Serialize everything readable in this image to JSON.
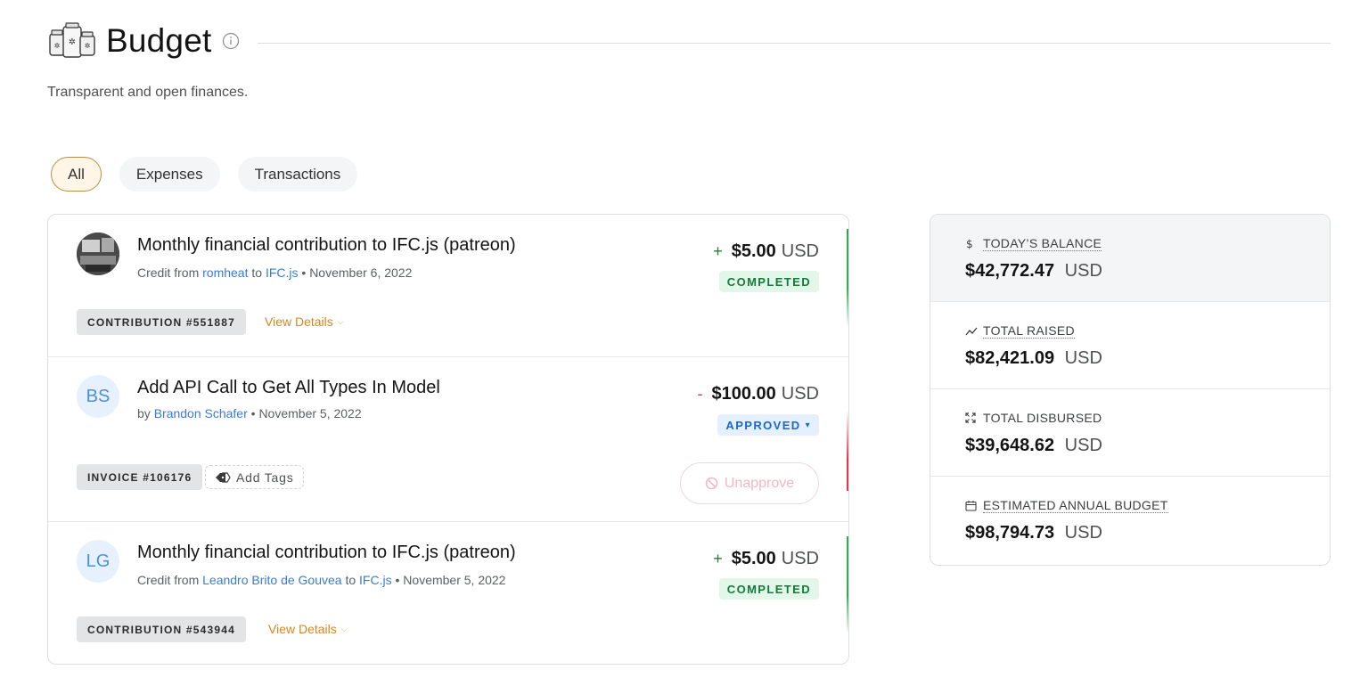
{
  "header": {
    "title": "Budget",
    "subtitle": "Transparent and open finances."
  },
  "tabs": [
    {
      "label": "All",
      "active": true
    },
    {
      "label": "Expenses",
      "active": false
    },
    {
      "label": "Transactions",
      "active": false
    }
  ],
  "transactions": [
    {
      "title": "Monthly financial contribution to IFC.js (patreon)",
      "meta_prefix": "Credit from",
      "from": "romheat",
      "meta_to": "to",
      "to": "IFC.js",
      "date": "• November 6, 2022",
      "sign": "+",
      "amount": "$5.00",
      "currency": "USD",
      "status": "COMPLETED",
      "tag": "CONTRIBUTION #551887",
      "action": "View Details",
      "avatar": "photo"
    },
    {
      "title": "Add API Call to Get All Types In Model",
      "meta_prefix": "by",
      "from": "Brandon Schafer",
      "date": "• November 5, 2022",
      "sign": "-",
      "amount": "$100.00",
      "currency": "USD",
      "status": "APPROVED",
      "tag": "INVOICE #106176",
      "add_tags": "Add Tags",
      "unapprove": "Unapprove",
      "avatar": "BS"
    },
    {
      "title": "Monthly financial contribution to IFC.js (patreon)",
      "meta_prefix": "Credit from",
      "from": "Leandro Brito de Gouvea",
      "meta_to": "to",
      "to": "IFC.js",
      "date": "• November 5, 2022",
      "sign": "+",
      "amount": "$5.00",
      "currency": "USD",
      "status": "COMPLETED",
      "tag": "CONTRIBUTION #543944",
      "action": "View Details",
      "avatar": "LG"
    }
  ],
  "summary": [
    {
      "icon": "dollar-icon",
      "label": "TODAY’S BALANCE",
      "value": "$42,772.47",
      "currency": "USD"
    },
    {
      "icon": "trend-up-icon",
      "label": "TOTAL RAISED",
      "value": "$82,421.09",
      "currency": "USD"
    },
    {
      "icon": "expand-arrows-icon",
      "label": "TOTAL DISBURSED",
      "value": "$39,648.62",
      "currency": "USD"
    },
    {
      "icon": "calendar-icon",
      "label": "ESTIMATED ANNUAL BUDGET",
      "value": "$98,794.73",
      "currency": "USD"
    }
  ],
  "colors": {
    "accent_orange": "#d6871f",
    "link_blue": "#3a7bd5",
    "completed_green": "#157a3a",
    "approved_blue": "#1d67c9",
    "expense_red": "#d6374f"
  }
}
